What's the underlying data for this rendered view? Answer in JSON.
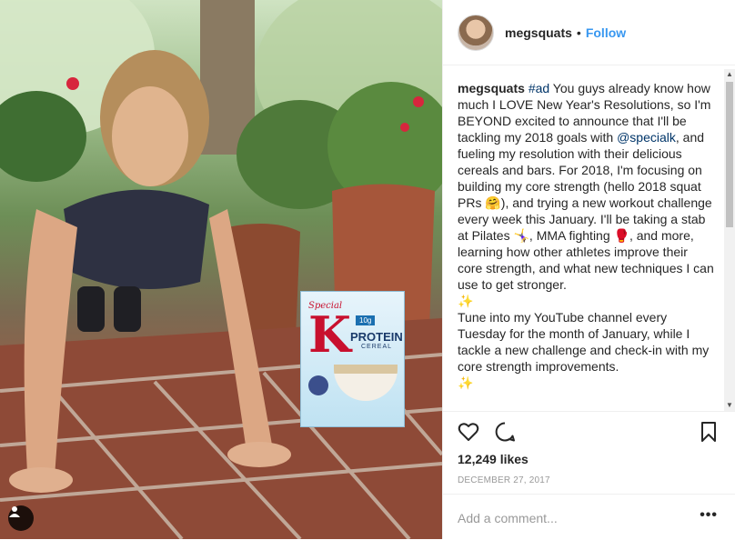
{
  "post": {
    "username": "megsquats",
    "separator": "•",
    "follow_label": "Follow"
  },
  "caption": {
    "username": "megsquats",
    "hashtag": "#ad",
    "part1": " You guys already know how much I LOVE New Year's Resolutions, so I'm BEYOND excited to announce that I'll be tackling my 2018 goals with ",
    "mention": "@specialk",
    "part2": ", and fueling my resolution with their delicious cereals and bars. For 2018, I'm focusing on building my core strength (hello 2018 squat PRs ",
    "emoji_hug": "🤗",
    "part3": "), and trying a new workout challenge every week this January. I'll be taking a stab at Pilates ",
    "emoji_pilates": "🤸‍♀️",
    "part4": ", MMA fighting ",
    "emoji_glove": "🥊",
    "part5": ", and more, learning how other athletes improve their core strength, and what new techniques I can use to get stronger.",
    "emoji_sparkle1": "✨",
    "part6": "Tune into my YouTube channel every Tuesday for the month of January, while I tackle a new challenge and check-in with my core strength improvements.",
    "emoji_sparkle2": "✨"
  },
  "product": {
    "brand": "Special",
    "logo_letter": "K",
    "name": "PROTEIN",
    "subname": "CEREAL",
    "badge": "10g"
  },
  "icons": {
    "like": "heart-icon",
    "comment": "comment-icon",
    "save": "bookmark-icon",
    "user_tag": "user-tag-icon",
    "more": "more-options-icon"
  },
  "engagement": {
    "likes": "12,249 likes",
    "date": "DECEMBER 27, 2017"
  },
  "comment": {
    "placeholder": "Add a comment...",
    "more_label": "•••"
  },
  "colors": {
    "link_blue": "#3897f0",
    "mention_navy": "#003569",
    "muted": "#999999"
  }
}
